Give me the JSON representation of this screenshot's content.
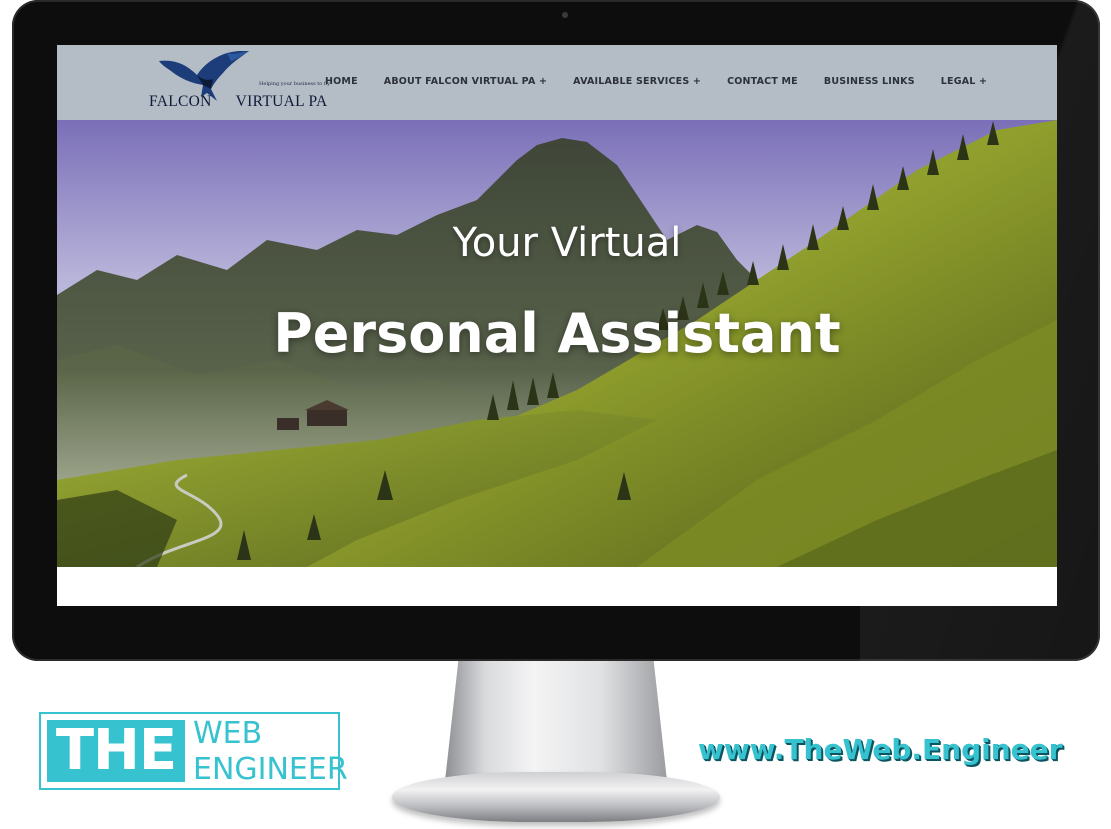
{
  "site": {
    "logo": {
      "name_part1": "FALCON",
      "name_part2": "VIRTUAL PA",
      "tagline": "Helping your business to fly"
    },
    "nav": [
      {
        "label": "HOME"
      },
      {
        "label": "ABOUT FALCON VIRTUAL PA +"
      },
      {
        "label": "AVAILABLE SERVICES +"
      },
      {
        "label": "CONTACT ME"
      },
      {
        "label": "BUSINESS LINKS"
      },
      {
        "label": "LEGAL +"
      }
    ],
    "hero": {
      "line1": "Your Virtual",
      "line2": "Personal Assistant"
    },
    "colors": {
      "header_bg": "#b4bcc6",
      "nav_text": "#2d3138",
      "logo_navy": "#0e1b38"
    }
  },
  "branding": {
    "logo_the": "THE",
    "logo_web": "WEB",
    "logo_engineer": "ENGINEER",
    "url": "www.TheWeb.Engineer",
    "accent": "#37c2d0"
  }
}
